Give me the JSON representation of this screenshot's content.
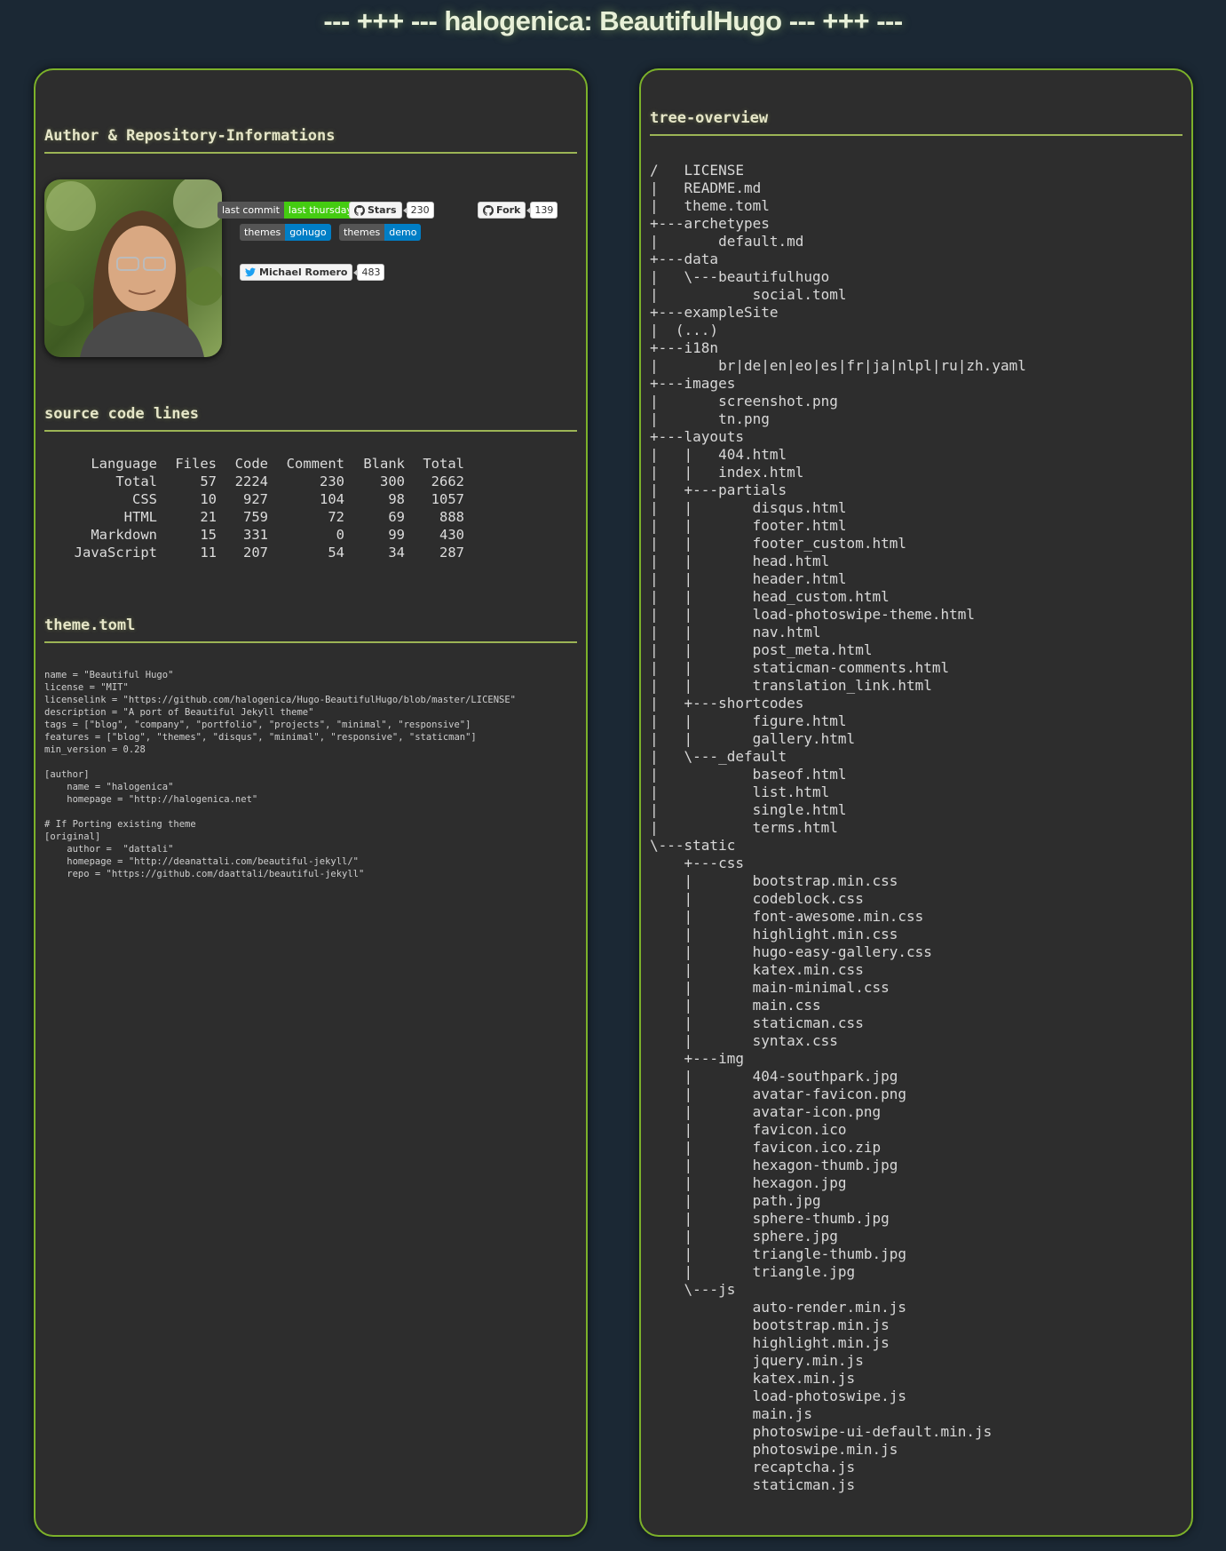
{
  "page": {
    "title": "--- +++ --- halogenica: BeautifulHugo --- +++ ---"
  },
  "colors": {
    "background": "#1b2834",
    "panel": "#2d2d2d",
    "panel_border": "#7cb12a",
    "badge_green": "#4c1",
    "badge_blue": "#007ec6"
  },
  "left": {
    "author_heading": "Author & Repository-Informations",
    "badges": {
      "last_commit_label": "last commit",
      "last_commit_value": "last thursday",
      "stars_label": "Stars",
      "stars_count": "230",
      "fork_label": "Fork",
      "fork_count": "139",
      "themes1_label": "themes",
      "themes1_value": "gohugo",
      "themes2_label": "themes",
      "themes2_value": "demo",
      "twitter_label": "Michael Romero",
      "twitter_count": "483"
    },
    "sloc_heading": "source code lines",
    "sloc": {
      "headers": [
        "Language",
        "Files",
        "Code",
        "Comment",
        "Blank",
        "Total"
      ],
      "rows": [
        [
          "Total",
          "57",
          "2224",
          "230",
          "300",
          "2662"
        ],
        [
          "CSS",
          "10",
          "927",
          "104",
          "98",
          "1057"
        ],
        [
          "HTML",
          "21",
          "759",
          "72",
          "69",
          "888"
        ],
        [
          "Markdown",
          "15",
          "331",
          "0",
          "99",
          "430"
        ],
        [
          "JavaScript",
          "11",
          "207",
          "54",
          "34",
          "287"
        ]
      ]
    },
    "toml_heading": "theme.toml",
    "toml_content": "name = \"Beautiful Hugo\"\nlicense = \"MIT\"\nlicenselink = \"https://github.com/halogenica/Hugo-BeautifulHugo/blob/master/LICENSE\"\ndescription = \"A port of Beautiful Jekyll theme\"\ntags = [\"blog\", \"company\", \"portfolio\", \"projects\", \"minimal\", \"responsive\"]\nfeatures = [\"blog\", \"themes\", \"disqus\", \"minimal\", \"responsive\", \"staticman\"]\nmin_version = 0.28\n\n[author]\n    name = \"halogenica\"\n    homepage = \"http://halogenica.net\"\n\n# If Porting existing theme\n[original]\n    author =  \"dattali\"\n    homepage = \"http://deanattali.com/beautiful-jekyll/\"\n    repo = \"https://github.com/daattali/beautiful-jekyll\""
  },
  "right": {
    "tree_heading": "tree-overview",
    "tree_content": "/   LICENSE\n|   README.md\n|   theme.toml\n+---archetypes\n|       default.md\n+---data\n|   \\---beautifulhugo\n|           social.toml\n+---exampleSite\n|  (...)\n+---i18n\n|       br|de|en|eo|es|fr|ja|nlpl|ru|zh.yaml\n+---images\n|       screenshot.png\n|       tn.png\n+---layouts\n|   |   404.html\n|   |   index.html\n|   +---partials\n|   |       disqus.html\n|   |       footer.html\n|   |       footer_custom.html\n|   |       head.html\n|   |       header.html\n|   |       head_custom.html\n|   |       load-photoswipe-theme.html\n|   |       nav.html\n|   |       post_meta.html\n|   |       staticman-comments.html\n|   |       translation_link.html\n|   +---shortcodes\n|   |       figure.html\n|   |       gallery.html\n|   \\---_default\n|           baseof.html\n|           list.html\n|           single.html\n|           terms.html\n\\---static\n    +---css\n    |       bootstrap.min.css\n    |       codeblock.css\n    |       font-awesome.min.css\n    |       highlight.min.css\n    |       hugo-easy-gallery.css\n    |       katex.min.css\n    |       main-minimal.css\n    |       main.css\n    |       staticman.css\n    |       syntax.css\n    +---img\n    |       404-southpark.jpg\n    |       avatar-favicon.png\n    |       avatar-icon.png\n    |       favicon.ico\n    |       favicon.ico.zip\n    |       hexagon-thumb.jpg\n    |       hexagon.jpg\n    |       path.jpg\n    |       sphere-thumb.jpg\n    |       sphere.jpg\n    |       triangle-thumb.jpg\n    |       triangle.jpg\n    \\---js\n            auto-render.min.js\n            bootstrap.min.js\n            highlight.min.js\n            jquery.min.js\n            katex.min.js\n            load-photoswipe.js\n            main.js\n            photoswipe-ui-default.min.js\n            photoswipe.min.js\n            recaptcha.js\n            staticman.js"
  }
}
